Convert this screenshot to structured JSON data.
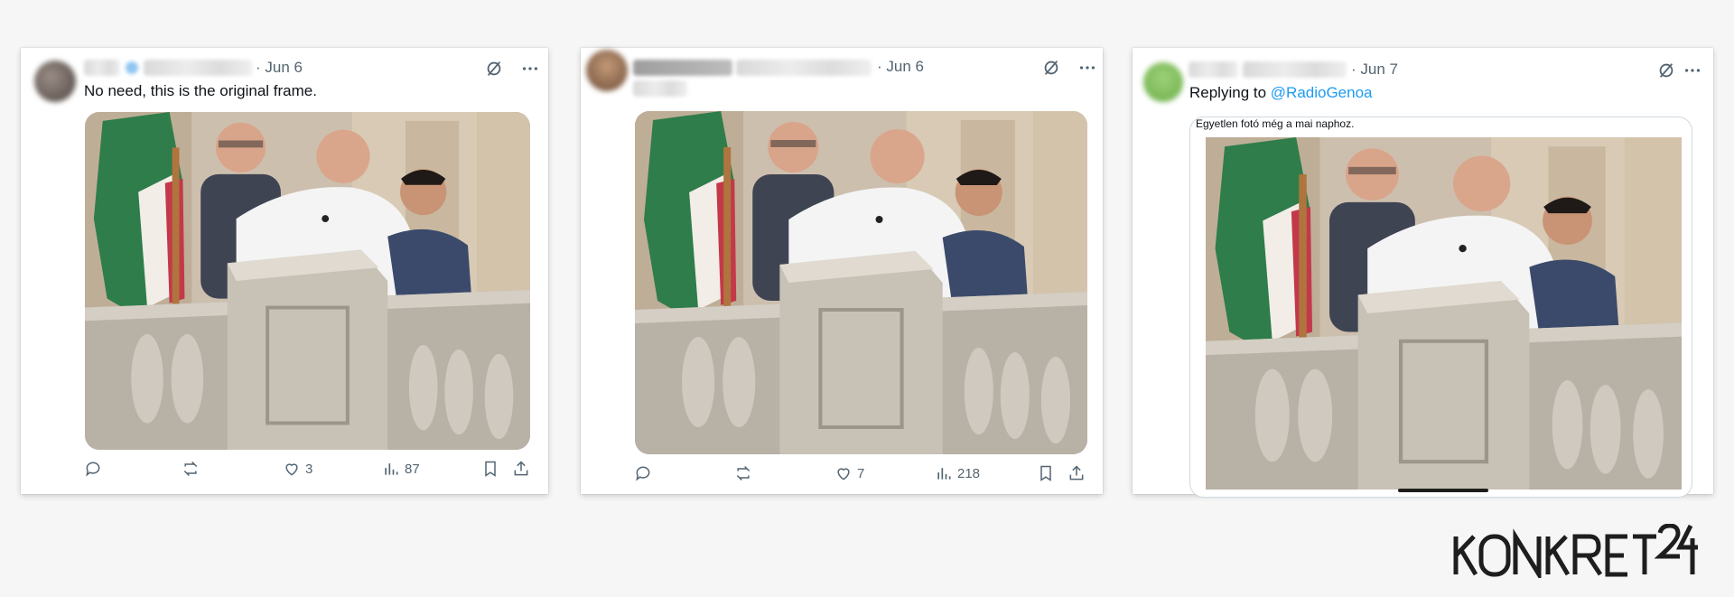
{
  "tweets": [
    {
      "date": "· Jun 6",
      "text": "No need, this is the original frame.",
      "actions": {
        "replies": "",
        "reposts": "",
        "likes": "3",
        "views": "87"
      }
    },
    {
      "date": "· Jun 6",
      "text": "",
      "actions": {
        "replies": "",
        "reposts": "",
        "likes": "7",
        "views": "218"
      }
    },
    {
      "date": "· Jun 7",
      "replying_prefix": "Replying to ",
      "replying_handle": "@RadioGenoa",
      "quote_caption": "Egyetlen fotó még a mai naphoz."
    }
  ],
  "icons": {
    "grok": "grok-icon",
    "more": "more-icon",
    "reply": "reply-icon",
    "repost": "repost-icon",
    "like": "like-icon",
    "views": "views-icon",
    "bookmark": "bookmark-icon",
    "share": "share-icon"
  },
  "colors": {
    "link": "#1d9bf0",
    "text": "#0f1419",
    "muted": "#536471",
    "logo": "#1e1e1e"
  },
  "brand": {
    "name": "KONKRET24"
  }
}
